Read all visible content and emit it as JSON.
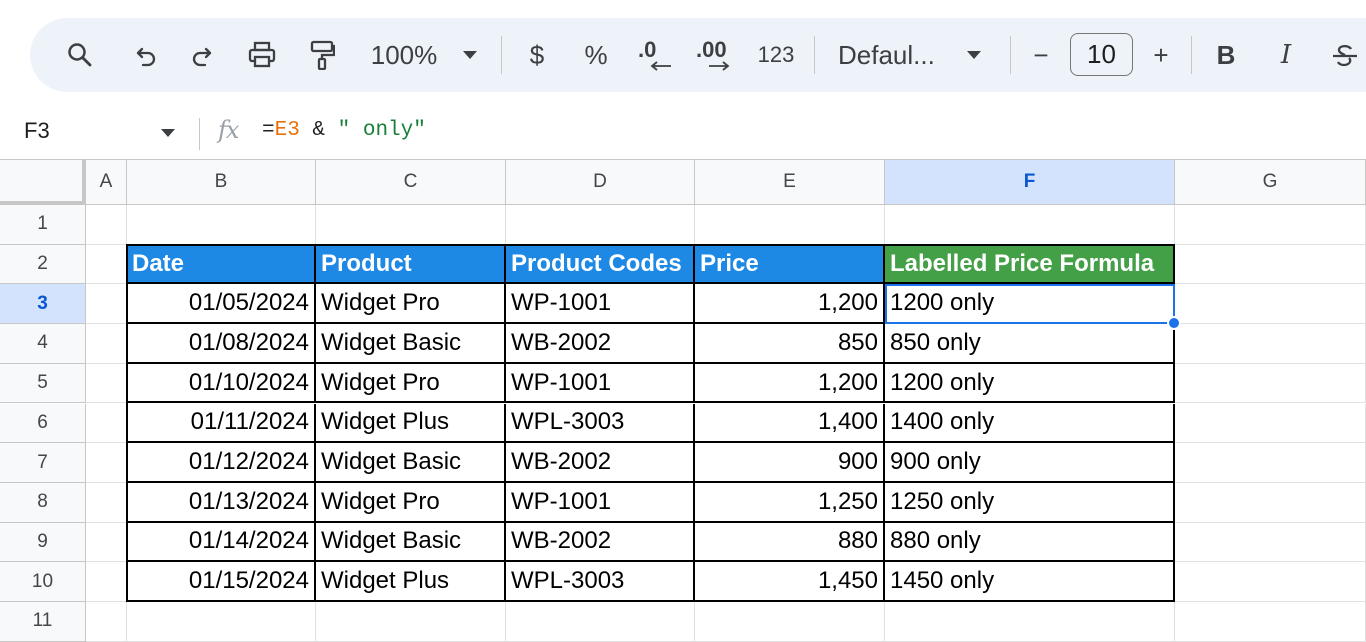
{
  "toolbar": {
    "zoom": "100%",
    "currency": "$",
    "percent": "%",
    "decrease_decimal": ".0",
    "increase_decimal": ".00",
    "number_format": "123",
    "font_name": "Defaul...",
    "font_size": "10",
    "bold": "B",
    "italic": "I",
    "minus": "−",
    "plus": "+"
  },
  "formula_bar": {
    "cell_ref": "F3",
    "fx": "fx",
    "formula_eq": "=",
    "formula_ref": "E3",
    "formula_op": " & ",
    "formula_str": "\" only\""
  },
  "columns": [
    "A",
    "B",
    "C",
    "D",
    "E",
    "F",
    "G"
  ],
  "rows": [
    "1",
    "2",
    "3",
    "4",
    "5",
    "6",
    "7",
    "8",
    "9",
    "10",
    "11"
  ],
  "selected_cell": "F3",
  "table": {
    "headers": [
      "Date",
      "Product",
      "Product Codes",
      "Price",
      "Labelled Price Formula"
    ],
    "data": [
      [
        "01/05/2024",
        "Widget Pro",
        "WP-1001",
        "1,200",
        "1200 only"
      ],
      [
        "01/08/2024",
        "Widget Basic",
        "WB-2002",
        "850",
        "850 only"
      ],
      [
        "01/10/2024",
        "Widget Pro",
        "WP-1001",
        "1,200",
        "1200 only"
      ],
      [
        "01/11/2024",
        "Widget Plus",
        "WPL-3003",
        "1,400",
        "1400 only"
      ],
      [
        "01/12/2024",
        "Widget Basic",
        "WB-2002",
        "900",
        "900 only"
      ],
      [
        "01/13/2024",
        "Widget Pro",
        "WP-1001",
        "1,250",
        "1250 only"
      ],
      [
        "01/14/2024",
        "Widget Basic",
        "WB-2002",
        "880",
        "880 only"
      ],
      [
        "01/15/2024",
        "Widget Plus",
        "WPL-3003",
        "1,450",
        "1450 only"
      ]
    ]
  },
  "colors": {
    "header_blue": "#1e88e5",
    "header_green": "#43a047",
    "selection": "#1a73e8"
  }
}
